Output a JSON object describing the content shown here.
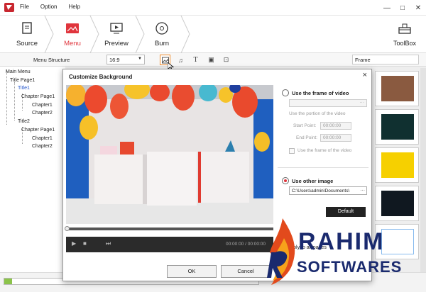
{
  "menubar": {
    "items": [
      "File",
      "Option",
      "Help"
    ]
  },
  "window_controls": {
    "minimize": "—",
    "maximize": "□",
    "close": "✕"
  },
  "steps": [
    {
      "label": "Source",
      "icon": "document-icon"
    },
    {
      "label": "Menu",
      "icon": "menu-image-icon"
    },
    {
      "label": "Preview",
      "icon": "monitor-play-icon"
    },
    {
      "label": "Burn",
      "icon": "disc-icon"
    }
  ],
  "toolbox": {
    "label": "ToolBox",
    "icon": "toolbox-icon"
  },
  "subbar": {
    "menu_structure_label": "Menu Structure",
    "aspect_ratio": "16:9",
    "frame_label": "Frame"
  },
  "tree": [
    {
      "label": "Main Menu"
    },
    {
      "label": "Title Page1"
    },
    {
      "label": "Title1",
      "selected": true
    },
    {
      "label": "Chapter Page1"
    },
    {
      "label": "Chapter1"
    },
    {
      "label": "Chapter2"
    },
    {
      "label": "Title2"
    },
    {
      "label": "Chapter Page1"
    },
    {
      "label": "Chapter1"
    },
    {
      "label": "Chapter2"
    }
  ],
  "dialog": {
    "title": "Customize Background",
    "close": "×",
    "use_frame_label": "Use the frame of video",
    "portion_label": "Use the portion of the video",
    "start_label": "Start Point:",
    "start_value": "00:00:00",
    "end_label": "End Point:",
    "end_value": "00:00:00",
    "use_frame_check": "Use the frame of the video",
    "use_other_label": "Use other image",
    "image_path": "C:\\Users\\admin\\Documents\\",
    "default_button": "Default",
    "apply_label": "Apply to all pages",
    "ok_button": "OK",
    "cancel_button": "Cancel",
    "timecode": "00:00:00 / 00:00:00"
  },
  "progress": {
    "fraction": 0.03
  },
  "watermark": {
    "line1": "RAHIM",
    "line2": "SOFTWARES"
  },
  "colors": {
    "accent": "#e0353d",
    "highlight": "#f08a2a",
    "dialog_radio_on": "#e0353d"
  }
}
